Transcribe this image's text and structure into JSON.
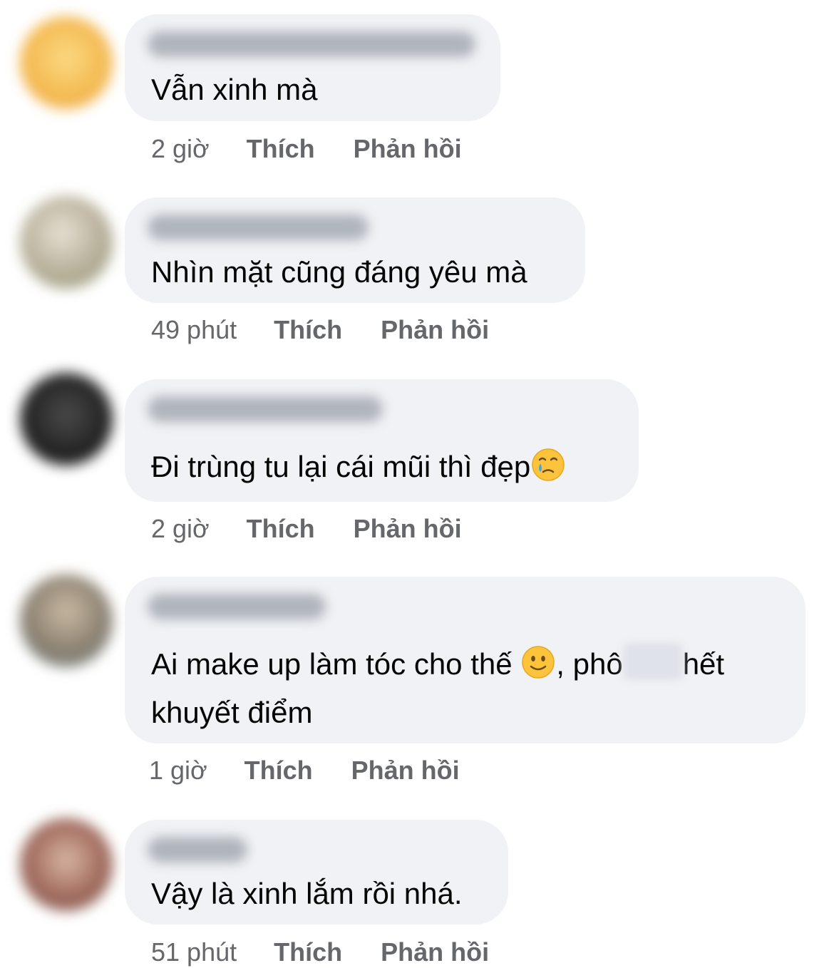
{
  "colors": {
    "bubble_bg": "#f0f2f5",
    "meta_text": "#65676b",
    "body_text": "#050505"
  },
  "comments": [
    {
      "text": "Vẫn xinh mà",
      "time": "2 giờ",
      "like_label": "Thích",
      "reply_label": "Phản hồi",
      "avatar_color": "#f2b64d"
    },
    {
      "text": "Nhìn mặt cũng đáng yêu mà",
      "time": "49 phút",
      "like_label": "Thích",
      "reply_label": "Phản hồi",
      "avatar_color": "#b9b4a2"
    },
    {
      "text": "Đi trùng tu lại cái mũi thì đẹp",
      "emoji_after": "crying-face-icon",
      "time": "2 giờ",
      "like_label": "Thích",
      "reply_label": "Phản hồi",
      "avatar_color": "#2a2a2a"
    },
    {
      "text_part1": "Ai make up làm tóc cho thế",
      "emoji_inline": "slightly-smiling-face-icon",
      "text_part2": ", phô",
      "text_part3": "hết",
      "text_line2": "khuyết điểm",
      "time": "1 giờ",
      "like_label": "Thích",
      "reply_label": "Phản hồi",
      "avatar_color": "#8b8070"
    },
    {
      "text": "Vậy là xinh lắm rồi nhá.",
      "time": "51 phút",
      "like_label": "Thích",
      "reply_label": "Phản hồi",
      "avatar_color": "#a06a5c"
    }
  ]
}
